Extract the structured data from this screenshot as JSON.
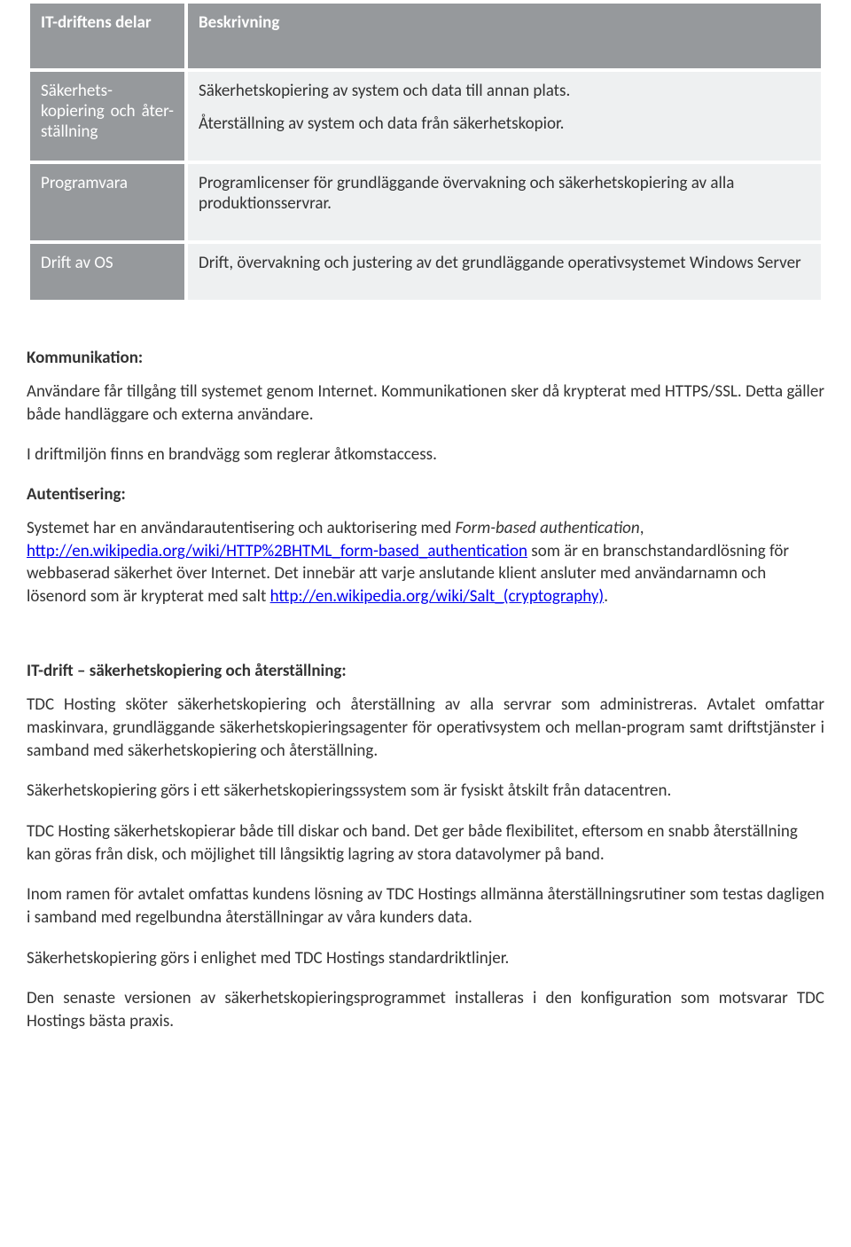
{
  "table": {
    "header_col1": "IT-driftens delar",
    "header_col2": "Beskrivning",
    "rows": [
      {
        "label": "Säkerhets-\nkopiering\noch åter-\nställning",
        "body": [
          "Säkerhetskopiering av system och data till annan plats.",
          "Återställning av system och data från säkerhetskopior."
        ]
      },
      {
        "label": "Programvara",
        "body": [
          "Programlicenser för grundläggande övervakning och säkerhetskopiering av alla produktionsservrar."
        ]
      },
      {
        "label": "Drift av OS",
        "body_justify": true,
        "body": [
          "Drift, övervakning och justering av det grundläggande operativsystemet Windows Server"
        ]
      }
    ]
  },
  "sections": {
    "komm": {
      "title": "Kommunikation:",
      "p1": "Användare får tillgång till systemet genom Internet. Kommunikationen sker då krypterat med HTTPS/SSL. Detta gäller både handläggare och externa användare.",
      "p2": "I driftmiljön finns en brandvägg som reglerar åtkomstaccess."
    },
    "aut": {
      "title": "Autentisering:",
      "p1a": "Systemet har en användarautentisering och auktorisering med ",
      "p1b_italic": "Form-based authentication",
      "p1c": ", ",
      "link1": "http://en.wikipedia.org/wiki/HTTP%2BHTML_form-based_authentication",
      "p1d": " som är en branschstandardlösning för webbaserad säkerhet över Internet. Det innebär att varje anslutande klient ansluter med användarnamn och lösenord som är krypterat med salt ",
      "link2": "http://en.wikipedia.org/wiki/Salt_(cryptography)",
      "p1e": "."
    },
    "drift": {
      "title": "IT-drift – säkerhetskopiering och återställning:",
      "p1": "TDC Hosting sköter säkerhetskopiering och återställning av alla servrar som administreras. Avtalet omfattar maskinvara, grundläggande säkerhetskopieringsagenter för operativsystem och mellan-program samt driftstjänster i samband med säkerhetskopiering och återställning.",
      "p2": "Säkerhetskopiering görs i ett säkerhetskopieringssystem som är fysiskt åtskilt från datacentren.",
      "p3": "TDC Hosting säkerhetskopierar både till diskar och band. Det ger både flexibilitet, eftersom en snabb återställning kan göras från disk, och möjlighet till långsiktig lagring av stora datavolymer på band.",
      "p4": "Inom ramen för avtalet omfattas kundens lösning av TDC Hostings allmänna återställningsrutiner som testas dagligen i samband med regelbundna återställningar av våra kunders data.",
      "p5": "Säkerhetskopiering görs i enlighet med TDC Hostings standardriktlinjer.",
      "p6": "Den senaste versionen av säkerhetskopieringsprogrammet installeras i den konfiguration som motsvarar TDC Hostings bästa praxis."
    }
  }
}
